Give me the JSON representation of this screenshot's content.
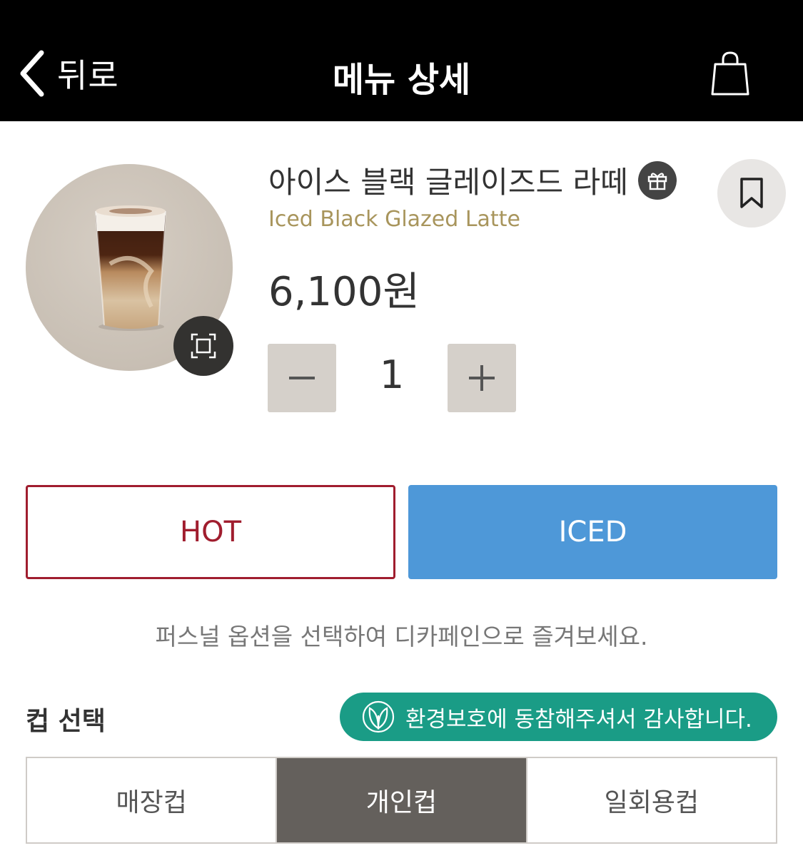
{
  "header": {
    "back_label": "뒤로",
    "title": "메뉴 상세",
    "back_icon": "chevron-left-icon",
    "cart_icon": "shopping-bag-icon"
  },
  "product": {
    "name_ko": "아이스 블랙 글레이즈드 라떼",
    "name_en": "Iced Black Glazed Latte",
    "price": "6,100원",
    "gift_icon": "gift-icon",
    "bookmark_icon": "bookmark-icon",
    "zoom_icon": "expand-icon"
  },
  "quantity": {
    "value": "1",
    "decrease_icon": "minus-icon",
    "increase_icon": "plus-icon"
  },
  "temperature": {
    "hot_label": "HOT",
    "iced_label": "ICED",
    "selected": "ICED"
  },
  "notice": "퍼스널 옵션을 선택하여 디카페인으로 즐겨보세요.",
  "cup": {
    "title": "컵 선택",
    "eco_message": "환경보호에 동참해주셔서 감사합니다.",
    "eco_icon": "leaf-icon",
    "options": [
      "매장컵",
      "개인컵",
      "일회용컵"
    ],
    "selected": "개인컵"
  },
  "colors": {
    "header_bg": "#000000",
    "hot_accent": "#a01d2e",
    "iced_accent": "#4e98d8",
    "eco_green": "#1a9c86",
    "selected_cup": "#64605c",
    "english_name": "#a8955c"
  }
}
